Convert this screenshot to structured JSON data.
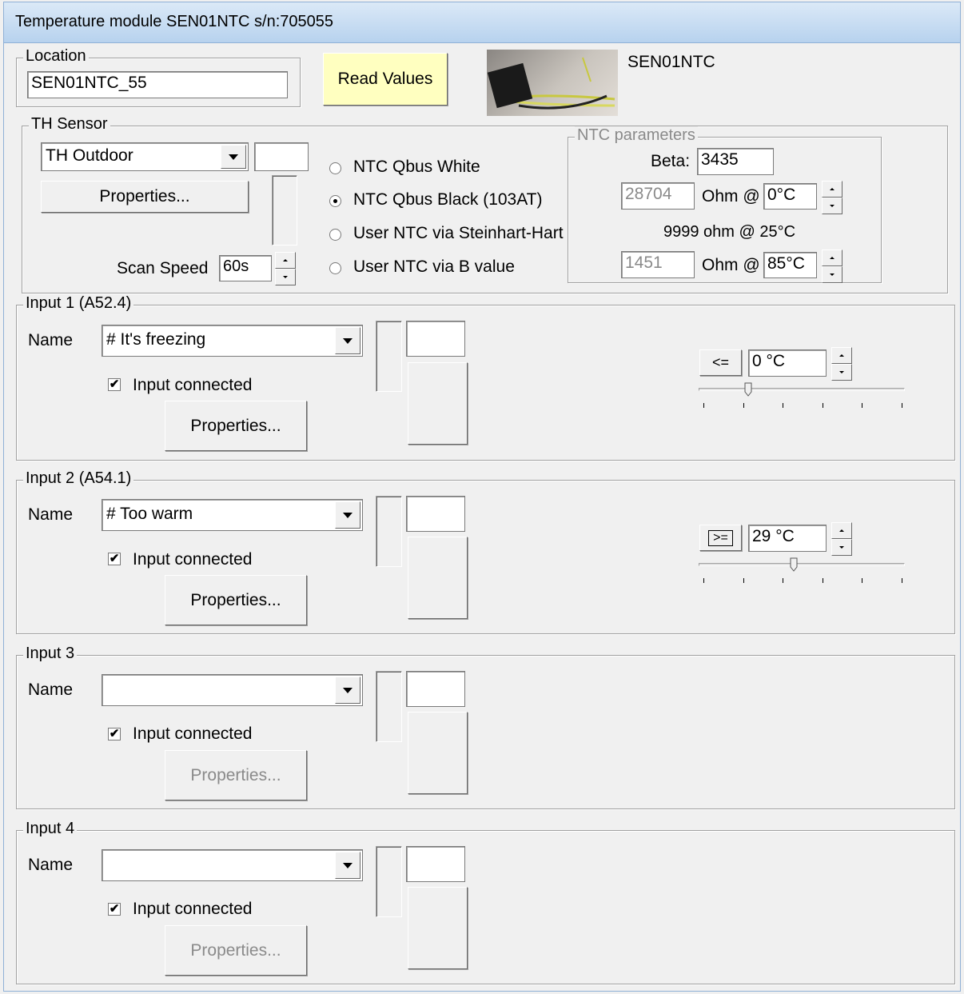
{
  "window": {
    "title": "Temperature module SEN01NTC s/n:705055"
  },
  "location": {
    "legend": "Location",
    "value": "SEN01NTC_55"
  },
  "read_values_label": "Read Values",
  "module_image_label": "SEN01NTC",
  "th_sensor": {
    "legend": "TH Sensor",
    "sensor_select": "TH Outdoor",
    "properties_label": "Properties...",
    "scan_speed_label": "Scan Speed",
    "scan_speed_value": "60s",
    "radio_options": [
      {
        "label": "NTC Qbus White",
        "selected": false
      },
      {
        "label": "NTC Qbus  Black (103AT)",
        "selected": true
      },
      {
        "label": "User NTC via Steinhart-Hart",
        "selected": false
      },
      {
        "label": "User NTC via B value",
        "selected": false
      }
    ]
  },
  "ntc_parameters": {
    "legend": "NTC parameters",
    "beta_label": "Beta:",
    "beta_value": "3435",
    "r1_value": "28704",
    "r1_unit": "Ohm @",
    "t1_value": "0°C",
    "mid_text": "9999 ohm @ 25°C",
    "r2_value": "1451",
    "r2_unit": "Ohm @",
    "t2_value": "85°C"
  },
  "inputs": [
    {
      "legend": "Input 1 (A52.4)",
      "name_label": "Name",
      "name_value": "# It's freezing",
      "connected_label": "Input connected",
      "connected": true,
      "properties_label": "Properties...",
      "properties_enabled": true,
      "operator": "<=",
      "threshold": "0 °C",
      "slider_fraction": 0.24
    },
    {
      "legend": "Input 2 (A54.1)",
      "name_label": "Name",
      "name_value": "# Too warm",
      "connected_label": "Input connected",
      "connected": true,
      "properties_label": "Properties...",
      "properties_enabled": true,
      "operator": ">=",
      "threshold": "29 °C",
      "slider_fraction": 0.46
    },
    {
      "legend": "Input 3",
      "name_label": "Name",
      "name_value": "",
      "connected_label": "Input connected",
      "connected": true,
      "properties_label": "Properties...",
      "properties_enabled": false
    },
    {
      "legend": "Input 4",
      "name_label": "Name",
      "name_value": "",
      "connected_label": "Input connected",
      "connected": true,
      "properties_label": "Properties...",
      "properties_enabled": false
    }
  ],
  "icons": {
    "dropdown": "chevron-down-icon",
    "spin": "spin-updown-icon",
    "check": "checkmark-icon"
  }
}
